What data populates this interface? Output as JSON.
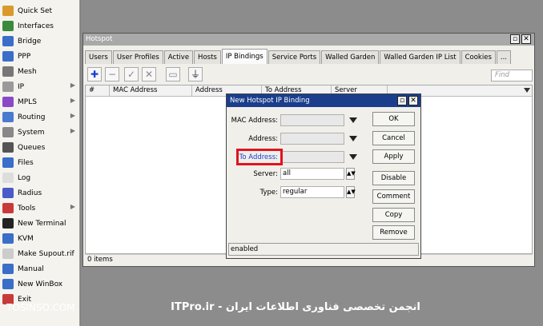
{
  "sidebar": {
    "items": [
      {
        "label": "Quick Set",
        "icon": "quick-set-icon",
        "color": "#d99a2b",
        "arrow": false
      },
      {
        "label": "Interfaces",
        "icon": "interfaces-icon",
        "color": "#3b8a3b",
        "arrow": false
      },
      {
        "label": "Bridge",
        "icon": "bridge-icon",
        "color": "#3a6ec8",
        "arrow": false
      },
      {
        "label": "PPP",
        "icon": "ppp-icon",
        "color": "#3a6ec8",
        "arrow": false
      },
      {
        "label": "Mesh",
        "icon": "mesh-icon",
        "color": "#777777",
        "arrow": false
      },
      {
        "label": "IP",
        "icon": "ip-icon",
        "color": "#9a9a9a",
        "arrow": true
      },
      {
        "label": "MPLS",
        "icon": "mpls-icon",
        "color": "#8a4ac8",
        "arrow": true
      },
      {
        "label": "Routing",
        "icon": "routing-icon",
        "color": "#4a7ad0",
        "arrow": true
      },
      {
        "label": "System",
        "icon": "system-gear-icon",
        "color": "#888888",
        "arrow": true
      },
      {
        "label": "Queues",
        "icon": "queues-icon",
        "color": "#555555",
        "arrow": false
      },
      {
        "label": "Files",
        "icon": "files-icon",
        "color": "#3a6ec8",
        "arrow": false
      },
      {
        "label": "Log",
        "icon": "log-icon",
        "color": "#dddddd",
        "arrow": false
      },
      {
        "label": "Radius",
        "icon": "radius-icon",
        "color": "#4a5ac8",
        "arrow": false
      },
      {
        "label": "Tools",
        "icon": "tools-icon",
        "color": "#c83a3a",
        "arrow": true
      },
      {
        "label": "New Terminal",
        "icon": "terminal-icon",
        "color": "#222222",
        "arrow": false
      },
      {
        "label": "KVM",
        "icon": "kvm-icon",
        "color": "#3a6ec8",
        "arrow": false
      },
      {
        "label": "Make Supout.rif",
        "icon": "supout-icon",
        "color": "#cccccc",
        "arrow": false
      },
      {
        "label": "Manual",
        "icon": "manual-icon",
        "color": "#3a6ec8",
        "arrow": false
      },
      {
        "label": "New WinBox",
        "icon": "winbox-icon",
        "color": "#3a6ec8",
        "arrow": false
      },
      {
        "label": "Exit",
        "icon": "exit-icon",
        "color": "#c83a3a",
        "arrow": false
      }
    ]
  },
  "hotspot": {
    "title": "Hotspot",
    "tabs": [
      "Users",
      "User Profiles",
      "Active",
      "Hosts",
      "IP Bindings",
      "Service Ports",
      "Walled Garden",
      "Walled Garden IP List",
      "Cookies",
      "..."
    ],
    "active_tab": "IP Bindings",
    "find_placeholder": "Find",
    "columns": [
      "#",
      "MAC Address",
      "Address",
      "To Address",
      "Server"
    ],
    "status": "0 items"
  },
  "dialog": {
    "title": "New Hotspot IP Binding",
    "fields": {
      "mac_label": "MAC Address:",
      "mac_value": "",
      "address_label": "Address:",
      "address_value": "",
      "to_address_label": "To Address:",
      "to_address_value": "",
      "server_label": "Server:",
      "server_value": "all",
      "type_label": "Type:",
      "type_value": "regular"
    },
    "buttons": {
      "ok": "OK",
      "cancel": "Cancel",
      "apply": "Apply",
      "disable": "Disable",
      "comment": "Comment",
      "copy": "Copy",
      "remove": "Remove"
    },
    "status": "enabled"
  },
  "footer": {
    "watermark": "TOSINSO.COM",
    "caption": "ITPro.ir - انجمن تخصصی فناوری اطلاعات ایران"
  },
  "colors": {
    "highlight": "#e0141e",
    "dialog_title": "#1b3e8c",
    "to_address_label": "#1a3fd0"
  }
}
